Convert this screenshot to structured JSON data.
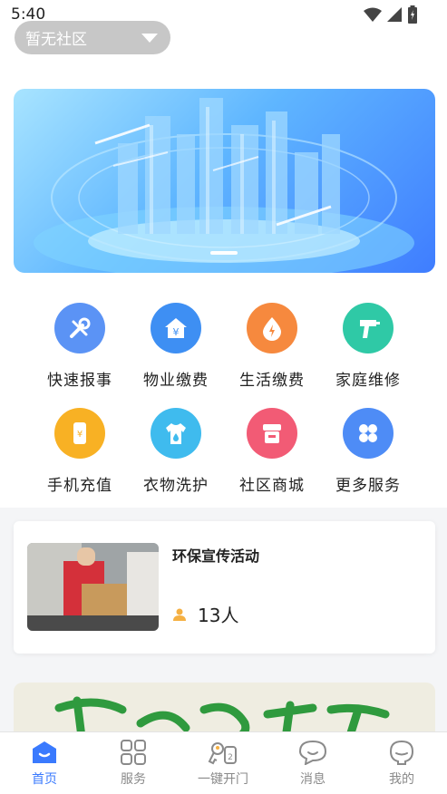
{
  "status_bar": {
    "time": "5:40",
    "icons": [
      "wifi-icon",
      "signal-icon",
      "battery-icon"
    ]
  },
  "header": {
    "community_label": "暂无社区"
  },
  "banner": {
    "slide_indicator_count": 1
  },
  "services": [
    {
      "label": "快速报事",
      "icon": "tools-icon",
      "color": "#5b93f5"
    },
    {
      "label": "物业缴费",
      "icon": "house-yen-icon",
      "color": "#3e8ff3"
    },
    {
      "label": "生活缴费",
      "icon": "utility-drop-icon",
      "color": "#f6893e"
    },
    {
      "label": "家庭维修",
      "icon": "drill-icon",
      "color": "#2fc9a6"
    },
    {
      "label": "手机充值",
      "icon": "phone-recharge-icon",
      "color": "#f8b124"
    },
    {
      "label": "衣物洗护",
      "icon": "shirt-icon",
      "color": "#3fbbee"
    },
    {
      "label": "社区商城",
      "icon": "store-icon",
      "color": "#f25b75"
    },
    {
      "label": "更多服务",
      "icon": "grid-more-icon",
      "color": "#4e8cf6"
    }
  ],
  "activity": {
    "title": "环保宣传活动",
    "participants": "13人"
  },
  "tabs": [
    {
      "label": "首页",
      "icon": "home-icon",
      "active": true
    },
    {
      "label": "服务",
      "icon": "apps-grid-icon",
      "active": false
    },
    {
      "label": "一键开门",
      "icon": "keys-icon",
      "active": false
    },
    {
      "label": "消息",
      "icon": "chat-bubble-icon",
      "active": false
    },
    {
      "label": "我的",
      "icon": "profile-icon",
      "active": false
    }
  ],
  "colors": {
    "accent": "#3a7afe",
    "tab_inactive": "#8a8a8a"
  }
}
